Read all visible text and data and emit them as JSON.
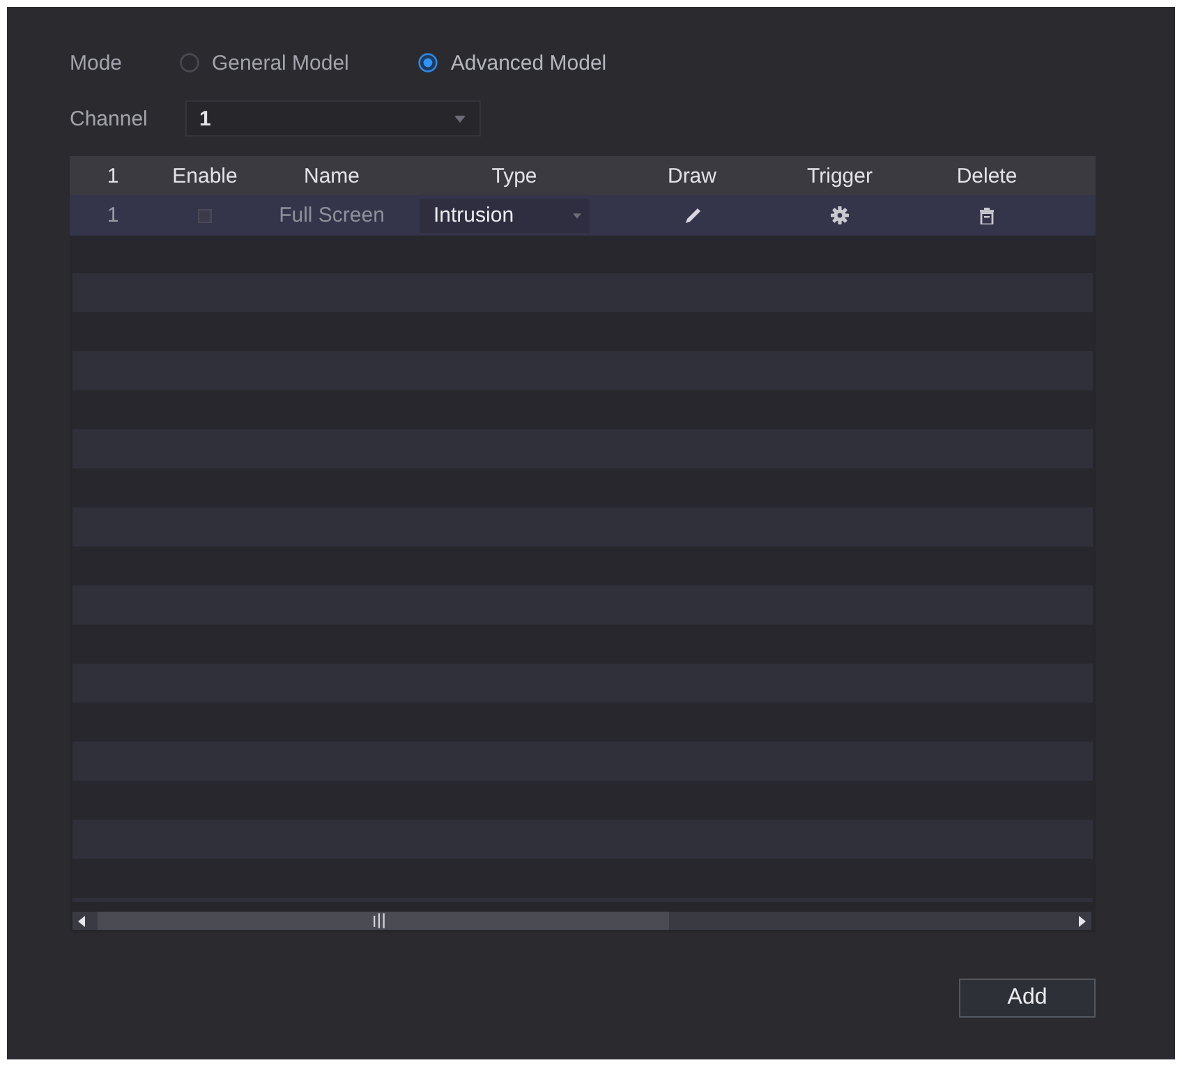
{
  "mode": {
    "label": "Mode",
    "options": [
      {
        "label": "General Model",
        "selected": false
      },
      {
        "label": "Advanced Model",
        "selected": true
      }
    ]
  },
  "channel": {
    "label": "Channel",
    "value": "1"
  },
  "table": {
    "columns": [
      "1",
      "Enable",
      "Name",
      "Type",
      "Draw",
      "Trigger",
      "Delete"
    ],
    "rows": [
      {
        "index": "1",
        "enabled": false,
        "name": "Full Screen",
        "type": "Intrusion"
      }
    ]
  },
  "buttons": [
    {
      "label": "Add"
    }
  ]
}
